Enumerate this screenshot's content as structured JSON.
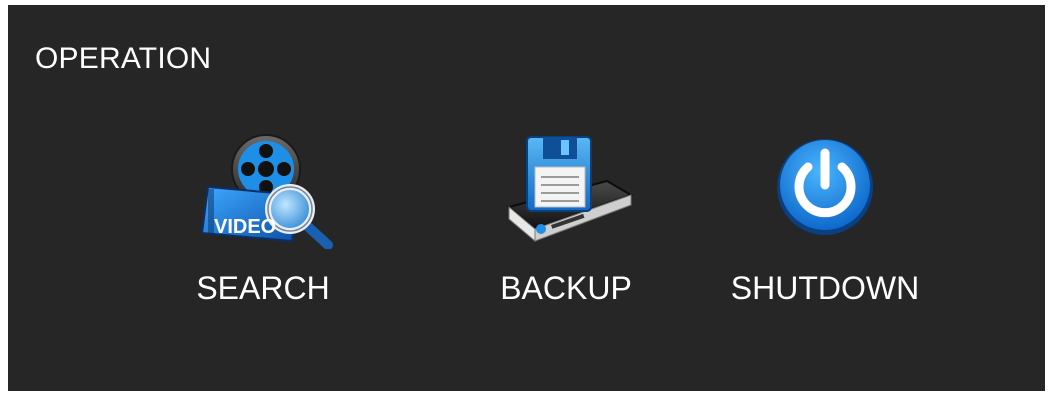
{
  "panel": {
    "title": "OPERATION"
  },
  "operations": [
    {
      "id": "search",
      "label": "SEARCH",
      "icon": "video-search-icon",
      "icon_text": "VIDEO"
    },
    {
      "id": "backup",
      "label": "BACKUP",
      "icon": "backup-drive-icon"
    },
    {
      "id": "shutdown",
      "label": "SHUTDOWN",
      "icon": "power-icon"
    }
  ],
  "colors": {
    "background": "#262626",
    "text": "#ffffff",
    "accent_blue": "#1e8fe6"
  }
}
